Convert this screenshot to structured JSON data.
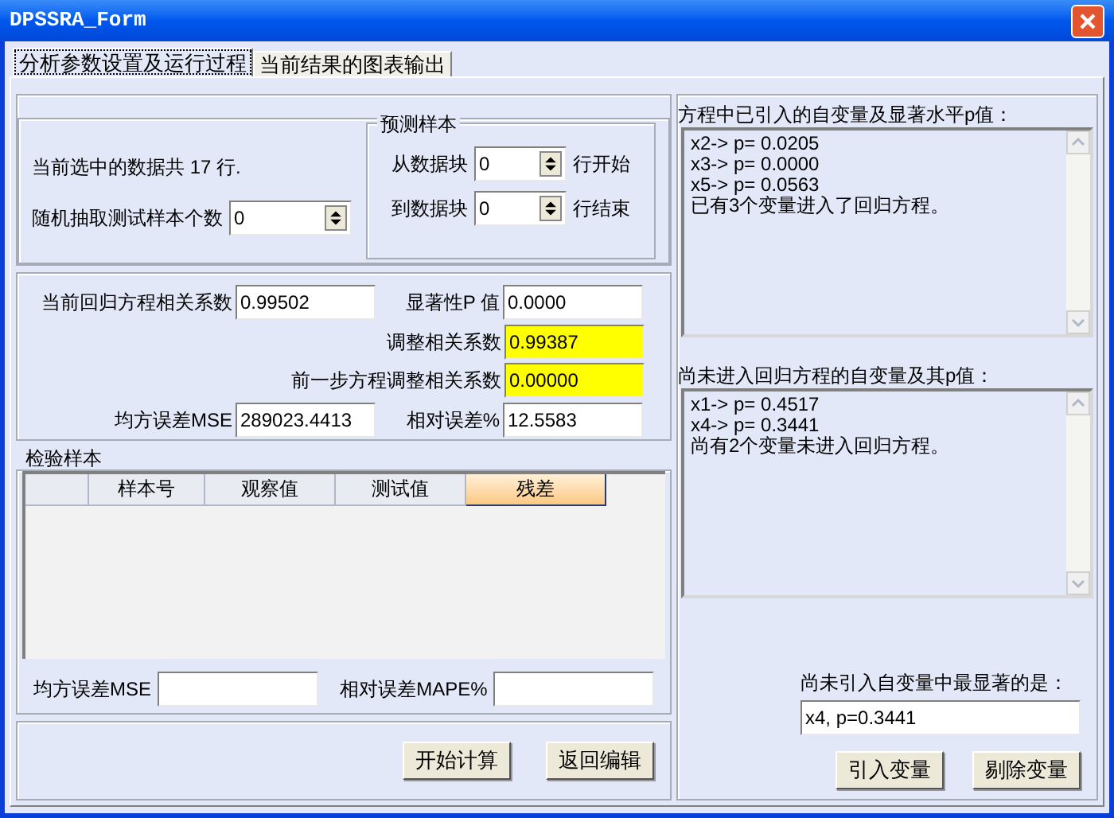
{
  "window": {
    "title": "DPSSRA_Form"
  },
  "tabs": [
    {
      "label": "分析参数设置及运行过程",
      "selected": true
    },
    {
      "label": "当前结果的图表输出",
      "selected": false
    }
  ],
  "data_info": {
    "rows_text": "当前选中的数据共 17 行.",
    "random_label": "随机抽取测试样本个数",
    "random_value": "0"
  },
  "forecast": {
    "title": "预测样本",
    "from_label": "从数据块",
    "from_value": "0",
    "from_suffix": "行开始",
    "to_label": "到数据块",
    "to_value": "0",
    "to_suffix": "行结束"
  },
  "stats": {
    "r_label": "当前回归方程相关系数",
    "r_value": "0.99502",
    "p_label": "显著性P 值",
    "p_value": "0.0000",
    "adj": [
      {
        "label": "调整相关系数",
        "value": "0.99387",
        "highlight": true
      },
      {
        "label": "前一步方程调整相关系数",
        "value": "0.00000",
        "highlight": true
      }
    ],
    "mse_label": "均方误差MSE",
    "mse_value": "289023.4413",
    "rel_label": "相对误差%",
    "rel_value": "12.5583"
  },
  "test_samples": {
    "title": "检验样本",
    "columns": [
      {
        "label": "样本号",
        "selected": false
      },
      {
        "label": "观察值",
        "selected": false
      },
      {
        "label": "测试值",
        "selected": false
      },
      {
        "label": "残差",
        "selected": true
      }
    ],
    "mse_label": "均方误差MSE",
    "mape_label": "相对误差MAPE%"
  },
  "buttons": [
    "开始计算",
    "返回编辑"
  ],
  "entered": {
    "label": "方程中已引入的自变量及显著水平p值：",
    "lines": [
      "x2-> p= 0.0205",
      "x3-> p= 0.0000",
      "x5-> p= 0.0563",
      "已有3个变量进入了回归方程。"
    ]
  },
  "not_entered": {
    "label": "尚未进入回归方程的自变量及其p值：",
    "lines": [
      "x1-> p= 0.4517",
      "x4-> p= 0.3441",
      "尚有2个变量未进入回归方程。"
    ]
  },
  "best": {
    "label": "尚未引入自变量中最显著的是：",
    "value": "x4, p=0.3441"
  },
  "variable_buttons": [
    "引入变量",
    "剔除变量"
  ]
}
